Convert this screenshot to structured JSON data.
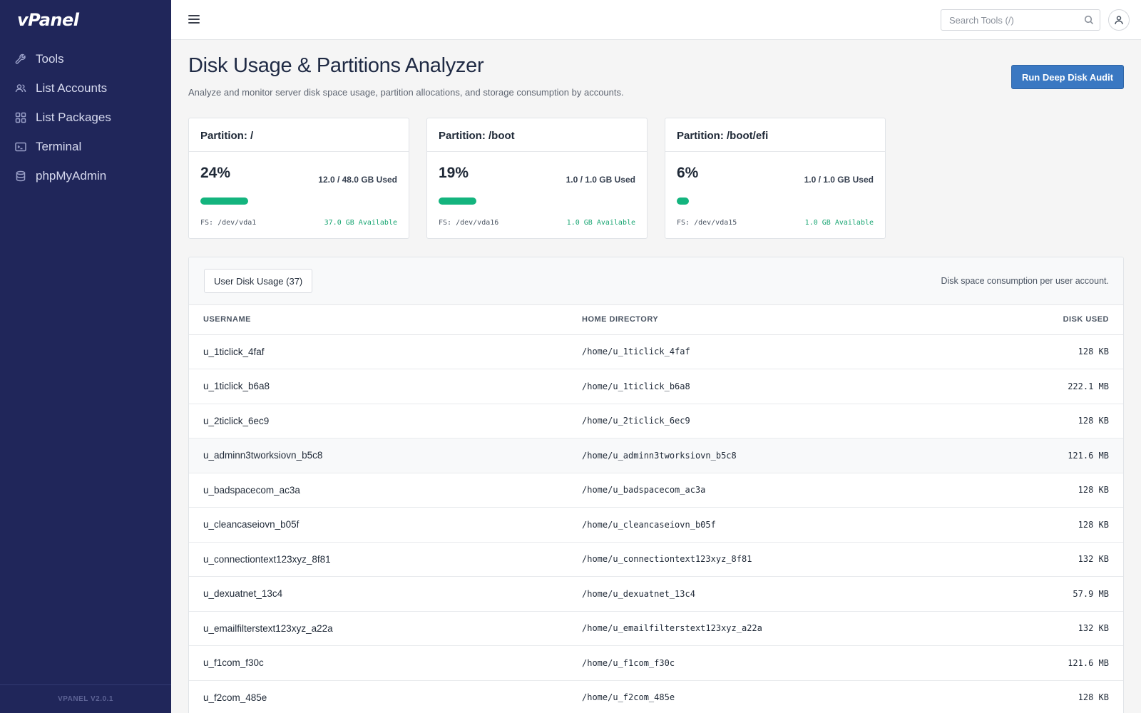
{
  "app": {
    "logo": "vPanel",
    "version": "VPANEL V2.0.1"
  },
  "sidebar": {
    "items": [
      {
        "label": "Tools",
        "icon": "wrench-icon"
      },
      {
        "label": "List Accounts",
        "icon": "users-icon"
      },
      {
        "label": "List Packages",
        "icon": "grid-icon"
      },
      {
        "label": "Terminal",
        "icon": "terminal-icon"
      },
      {
        "label": "phpMyAdmin",
        "icon": "database-icon"
      }
    ]
  },
  "topbar": {
    "search_placeholder": "Search Tools (/)"
  },
  "page": {
    "title": "Disk Usage & Partitions Analyzer",
    "subtitle": "Analyze and monitor server disk space usage, partition allocations, and storage consumption by accounts.",
    "audit_button": "Run Deep Disk Audit"
  },
  "partitions": [
    {
      "title": "Partition: /",
      "percent_label": "24%",
      "percent": 24,
      "used": "12.0 / 48.0 GB Used",
      "fs": "FS: /dev/vda1",
      "available": "37.0 GB Available"
    },
    {
      "title": "Partition: /boot",
      "percent_label": "19%",
      "percent": 19,
      "used": "1.0 / 1.0 GB Used",
      "fs": "FS: /dev/vda16",
      "available": "1.0 GB Available"
    },
    {
      "title": "Partition: /boot/efi",
      "percent_label": "6%",
      "percent": 6,
      "used": "1.0 / 1.0 GB Used",
      "fs": "FS: /dev/vda15",
      "available": "1.0 GB Available"
    }
  ],
  "usage": {
    "tab_label": "User Disk Usage (37)",
    "description": "Disk space consumption per user account.",
    "columns": {
      "username": "USERNAME",
      "home": "HOME DIRECTORY",
      "used": "DISK USED"
    },
    "rows": [
      {
        "username": "u_1ticlick_4faf",
        "home": "/home/u_1ticlick_4faf",
        "used": "128 KB"
      },
      {
        "username": "u_1ticlick_b6a8",
        "home": "/home/u_1ticlick_b6a8",
        "used": "222.1 MB"
      },
      {
        "username": "u_2ticlick_6ec9",
        "home": "/home/u_2ticlick_6ec9",
        "used": "128 KB"
      },
      {
        "username": "u_adminn3tworksiovn_b5c8",
        "home": "/home/u_adminn3tworksiovn_b5c8",
        "used": "121.6 MB"
      },
      {
        "username": "u_badspacecom_ac3a",
        "home": "/home/u_badspacecom_ac3a",
        "used": "128 KB"
      },
      {
        "username": "u_cleancaseiovn_b05f",
        "home": "/home/u_cleancaseiovn_b05f",
        "used": "128 KB"
      },
      {
        "username": "u_connectiontext123xyz_8f81",
        "home": "/home/u_connectiontext123xyz_8f81",
        "used": "132 KB"
      },
      {
        "username": "u_dexuatnet_13c4",
        "home": "/home/u_dexuatnet_13c4",
        "used": "57.9 MB"
      },
      {
        "username": "u_emailfilterstext123xyz_a22a",
        "home": "/home/u_emailfilterstext123xyz_a22a",
        "used": "132 KB"
      },
      {
        "username": "u_f1com_f30c",
        "home": "/home/u_f1com_f30c",
        "used": "121.6 MB"
      },
      {
        "username": "u_f2com_485e",
        "home": "/home/u_f2com_485e",
        "used": "128 KB"
      }
    ]
  },
  "colors": {
    "sidebar": "#20265a",
    "accent": "#3a78c2",
    "progress": "#14b47e",
    "available": "#18a572"
  }
}
